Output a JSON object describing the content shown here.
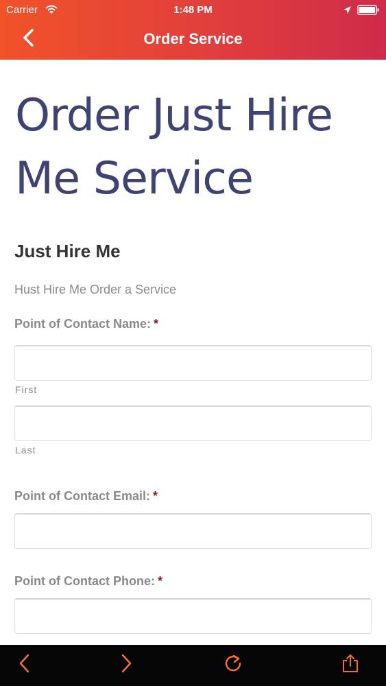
{
  "status_bar": {
    "carrier": "Carrier",
    "time": "1:48 PM",
    "icons": [
      "wifi-icon",
      "location-arrow-icon",
      "battery-icon"
    ]
  },
  "nav": {
    "title": "Order Service",
    "back_icon": "chevron-left-icon"
  },
  "page": {
    "title": "Order Just Hire Me Service"
  },
  "form": {
    "title": "Just Hire Me",
    "description": "Hust Hire Me Order a Service",
    "required_mark": "*",
    "contact_name": {
      "label": "Point of Contact Name:",
      "first_value": "",
      "first_sublabel": "First",
      "last_value": "",
      "last_sublabel": "Last"
    },
    "contact_email": {
      "label": "Point of Contact Email:",
      "value": ""
    },
    "contact_phone": {
      "label": "Point of Contact Phone:",
      "value": ""
    }
  },
  "toolbar": {
    "icons": [
      "back-arrow-icon",
      "forward-arrow-icon",
      "reload-icon",
      "share-icon"
    ]
  },
  "colors": {
    "header_gradient_start": "#f0532a",
    "header_gradient_end": "#cf2b4b",
    "title_color": "#3f4373",
    "toolbar_bg": "#050505",
    "toolbar_icon": "#f0732a",
    "required": "#8b1a1a"
  }
}
